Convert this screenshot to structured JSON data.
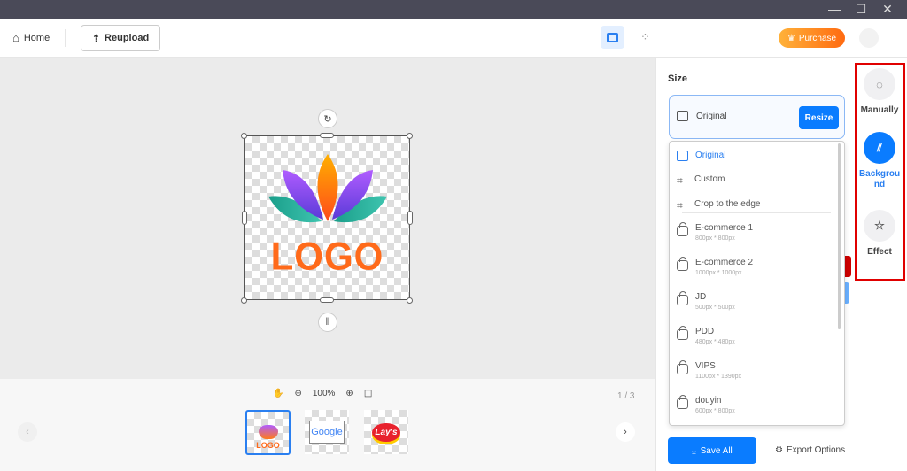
{
  "window": {
    "minimize": "—",
    "maximize": "☐",
    "close": "✕"
  },
  "topbar": {
    "home_label": "Home",
    "reupload_label": "Reupload",
    "purchase_label": "Purchase"
  },
  "canvas": {
    "logo_text": "LOGO"
  },
  "toolbar": {
    "zoom": "100%",
    "page_counter": "1 / 3"
  },
  "thumbnails": [
    {
      "label": "LOGO",
      "selected": true
    },
    {
      "label": "Google"
    },
    {
      "label": "Lay's"
    }
  ],
  "size_panel": {
    "title": "Size",
    "selected": "Original",
    "resize_label": "Resize",
    "options": [
      {
        "label": "Original",
        "active": true
      },
      {
        "label": "Custom"
      },
      {
        "label": "Crop to the edge"
      },
      {
        "label": "E-commerce 1",
        "dims": "800px * 800px"
      },
      {
        "label": "E-commerce 2",
        "dims": "1000px * 1000px"
      },
      {
        "label": "JD",
        "dims": "500px * 500px"
      },
      {
        "label": "PDD",
        "dims": "480px * 480px"
      },
      {
        "label": "VIPS",
        "dims": "1100px * 1390px"
      },
      {
        "label": "douyin",
        "dims": "600px * 800px"
      }
    ],
    "save_all_label": "Save All",
    "export_options_label": "Export Options"
  },
  "rail": {
    "manually": "Manually",
    "background": "Background",
    "effect": "Effect"
  },
  "colors": {
    "accent": "#0a7cff",
    "titlebar": "#4a4a58",
    "highlight": "#e00000",
    "purchase_from": "#ffb23a",
    "purchase_to": "#ff6a10"
  }
}
